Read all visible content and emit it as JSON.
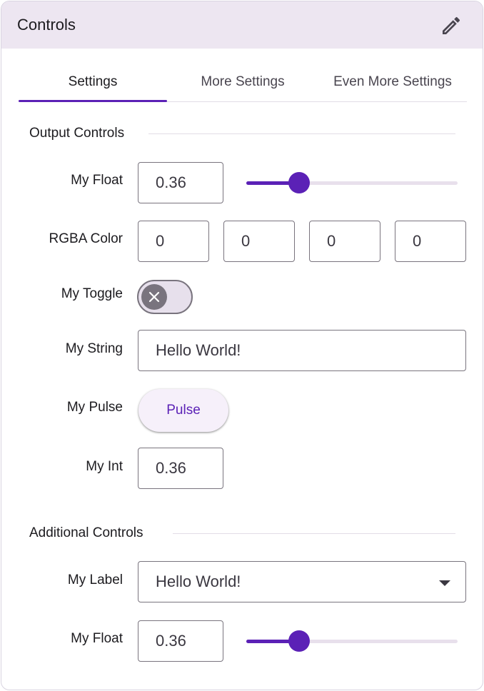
{
  "header": {
    "title": "Controls",
    "edit_icon": "pencil-icon"
  },
  "tabs": [
    {
      "label": "Settings",
      "active": true
    },
    {
      "label": "More Settings",
      "active": false
    },
    {
      "label": "Even More Settings",
      "active": false
    }
  ],
  "output_controls": {
    "title": "Output Controls",
    "my_float": {
      "label": "My Float",
      "value": "0.36",
      "slider_fraction": 0.25
    },
    "rgba": {
      "label": "RGBA Color",
      "r": "0",
      "g": "0",
      "b": "0",
      "a": "0"
    },
    "my_toggle": {
      "label": "My Toggle",
      "on": false,
      "knob_icon": "close-icon"
    },
    "my_string": {
      "label": "My String",
      "value": "Hello World!"
    },
    "my_pulse": {
      "label": "My Pulse",
      "button_label": "Pulse"
    },
    "my_int": {
      "label": "My Int",
      "value": "0.36"
    }
  },
  "additional_controls": {
    "title": "Additional Controls",
    "my_label": {
      "label": "My Label",
      "selected": "Hello World!"
    },
    "my_float": {
      "label": "My Float",
      "value": "0.36",
      "slider_fraction": 0.25
    }
  },
  "colors": {
    "accent": "#5b21b6",
    "header_bg": "#ede6f1",
    "track": "#e8e0ec"
  }
}
